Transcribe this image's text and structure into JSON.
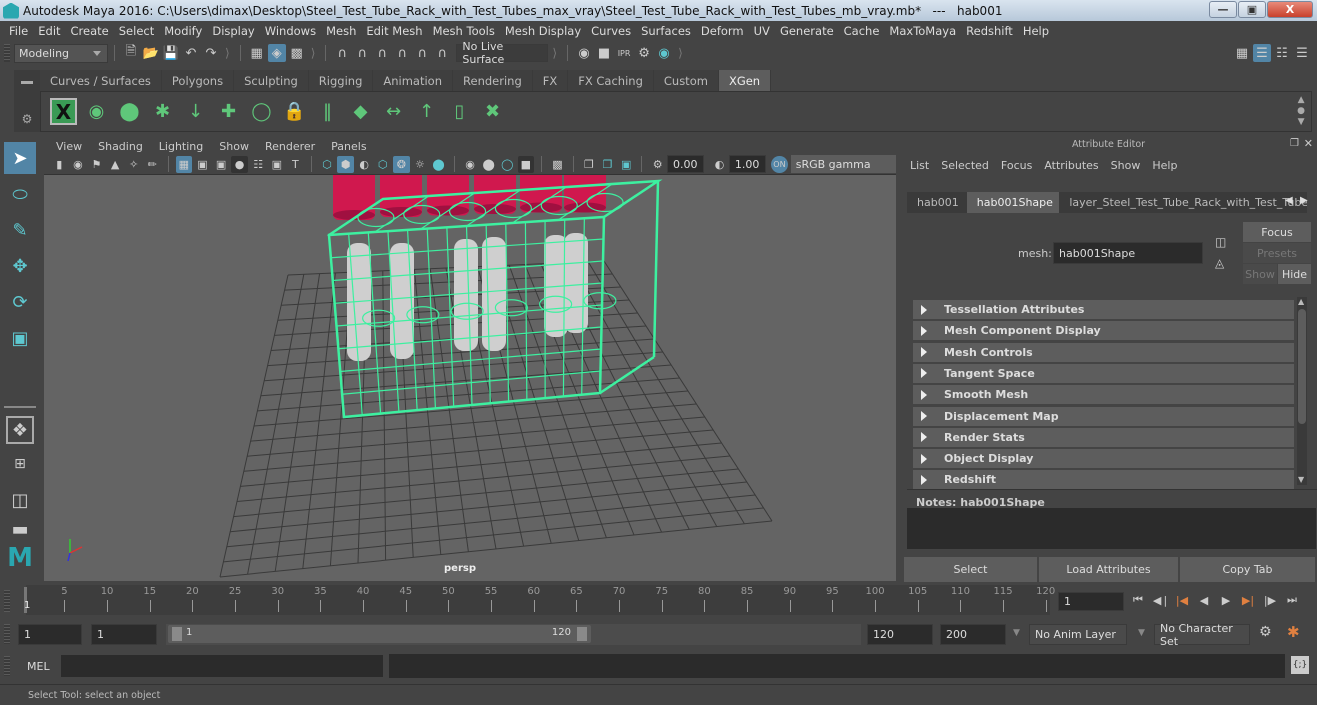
{
  "window": {
    "title": "Autodesk Maya 2016: C:\\Users\\dimax\\Desktop\\Steel_Test_Tube_Rack_with_Test_Tubes_max_vray\\Steel_Test_Tube_Rack_with_Test_Tubes_mb_vray.mb*   ---   hab001",
    "minimize": "—",
    "restore": "▣",
    "close": "X"
  },
  "menubar": [
    "File",
    "Edit",
    "Create",
    "Select",
    "Modify",
    "Display",
    "Windows",
    "Mesh",
    "Edit Mesh",
    "Mesh Tools",
    "Mesh Display",
    "Curves",
    "Surfaces",
    "Deform",
    "UV",
    "Generate",
    "Cache",
    "MaxToMaya",
    "Redshift",
    "Help"
  ],
  "statusline": {
    "menuset": "Modeling",
    "live_surface": "No Live Surface",
    "file_icons": [
      "new-scene-icon",
      "open-scene-icon",
      "save-scene-icon",
      "undo-icon",
      "redo-icon"
    ],
    "select_icons": [
      "select-by-hierarchy-icon",
      "select-by-object-icon",
      "select-by-component-icon"
    ],
    "snap_icons": [
      "snap-grid-icon",
      "snap-curve-icon",
      "snap-point-icon",
      "snap-view-plane-icon",
      "snap-live-icon",
      "snap-make-live-icon"
    ],
    "render_icons": [
      "render-view-icon",
      "render-frame-icon",
      "ipr-render-icon",
      "render-settings-icon",
      "hypershade-icon"
    ],
    "right_icons": [
      "modeling-toolkit-icon",
      "attribute-editor-toggle-icon",
      "tool-settings-toggle-icon",
      "channel-box-toggle-icon"
    ]
  },
  "shelf": {
    "tabs": [
      "Curves / Surfaces",
      "Polygons",
      "Sculpting",
      "Rigging",
      "Animation",
      "Rendering",
      "FX",
      "FX Caching",
      "Custom",
      "XGen"
    ],
    "active_tab": "XGen",
    "icons": [
      "xgen-editor-icon",
      "xgen-preview-icon",
      "xgen-clear-preview-icon",
      "xgen-add-guides-icon",
      "xgen-place-guides-icon",
      "xgen-add-guide-icon",
      "xgen-sculpt-guide-icon",
      "xgen-lock-guide-icon",
      "xgen-select-guides-icon",
      "xgen-region-icon",
      "xgen-flip-guides-icon",
      "xgen-guide-length-icon",
      "xgen-normalize-guides-icon",
      "xgen-delete-guides-icon"
    ]
  },
  "toolbox": [
    "select-tool-icon",
    "lasso-tool-icon",
    "paint-select-tool-icon",
    "move-tool-icon",
    "rotate-tool-icon",
    "scale-tool-icon"
  ],
  "layouts": [
    "single-perspective-layout-icon",
    "four-view-layout-icon",
    "persp-outliner-layout-icon",
    "persp-graph-layout-icon"
  ],
  "viewport": {
    "menu": [
      "View",
      "Shading",
      "Lighting",
      "Show",
      "Renderer",
      "Panels"
    ],
    "exposure": "0.00",
    "gamma": "1.00",
    "color_space": "sRGB gamma",
    "camera": "persp",
    "selection_color": "#3df0a0",
    "cap_color": "#d0184e"
  },
  "attribute_editor": {
    "title": "Attribute Editor",
    "menu": [
      "List",
      "Selected",
      "Focus",
      "Attributes",
      "Show",
      "Help"
    ],
    "tabs": [
      "hab001",
      "hab001Shape",
      "layer_Steel_Test_Tube_Rack_with_Test_Tube"
    ],
    "active_tab": "hab001Shape",
    "mesh_label": "mesh:",
    "mesh_value": "hab001Shape",
    "focus": "Focus",
    "presets": "Presets",
    "show": "Show",
    "hide": "Hide",
    "sections": [
      "Tessellation Attributes",
      "Mesh Component Display",
      "Mesh Controls",
      "Tangent Space",
      "Smooth Mesh",
      "Displacement Map",
      "Render Stats",
      "Object Display",
      "Redshift"
    ],
    "notes_label": "Notes:  hab001Shape",
    "buttons": [
      "Select",
      "Load Attributes",
      "Copy Tab"
    ]
  },
  "timeline": {
    "ticks": [
      5,
      10,
      15,
      20,
      25,
      30,
      35,
      40,
      45,
      50,
      55,
      60,
      65,
      70,
      75,
      80,
      85,
      90,
      95,
      100,
      105,
      110,
      115,
      120
    ],
    "start": 1,
    "end": 120,
    "current_frame": "1",
    "current_frame_marker": "1"
  },
  "range": {
    "start": "1",
    "playback_start": "1",
    "slider_start": "1",
    "slider_end": "120",
    "playback_end": "120",
    "end": "200",
    "anim_layer": "No Anim Layer",
    "character_set": "No Character Set"
  },
  "command_line": {
    "label": "MEL",
    "input": "",
    "result": ""
  },
  "help_line": "Select Tool: select an object"
}
